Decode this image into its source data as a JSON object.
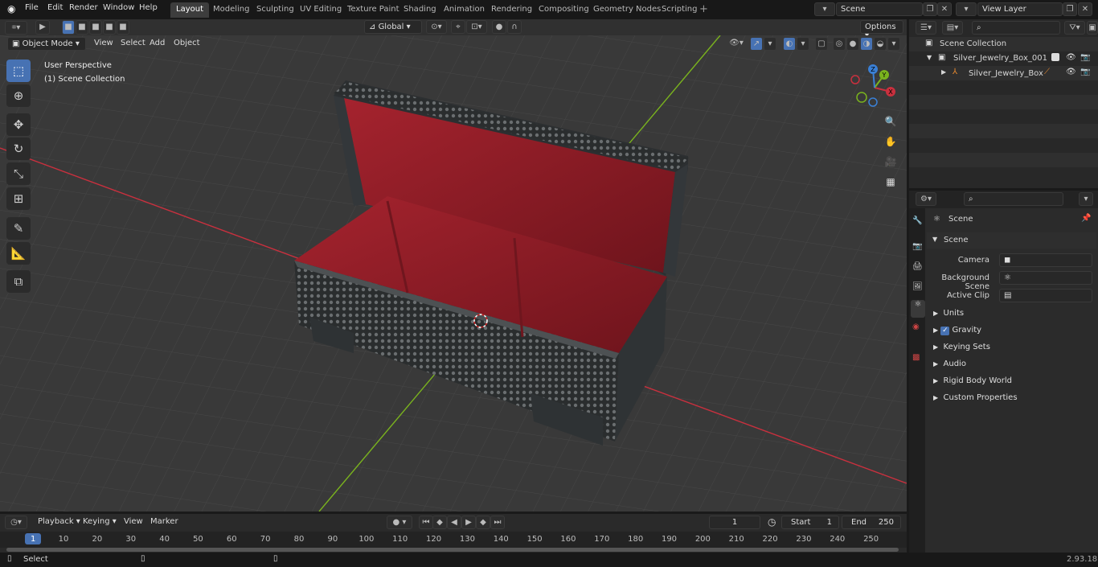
{
  "menu": [
    "File",
    "Edit",
    "Render",
    "Window",
    "Help"
  ],
  "workspaces": [
    "Layout",
    "Modeling",
    "Sculpting",
    "UV Editing",
    "Texture Paint",
    "Shading",
    "Animation",
    "Rendering",
    "Compositing",
    "Geometry Nodes",
    "Scripting"
  ],
  "scene_field": "Scene",
  "view_layer_field": "View Layer",
  "viewport": {
    "mode": "Object Mode",
    "menus": [
      "View",
      "Select",
      "Add",
      "Object"
    ],
    "transform_orientation": "Global",
    "options_label": "Options",
    "overlay_line1": "User Perspective",
    "overlay_line2": "(1) Scene Collection",
    "gizmo_axes": [
      "X",
      "Y",
      "Z"
    ]
  },
  "outliner": {
    "root": "Scene Collection",
    "collection": "Silver_Jewelry_Box_001",
    "object": "Silver_Jewelry_Box"
  },
  "properties": {
    "header": "Scene",
    "panel": "Scene",
    "fields": [
      {
        "label": "Camera",
        "value": ""
      },
      {
        "label": "Background Scene",
        "value": ""
      },
      {
        "label": "Active Clip",
        "value": ""
      }
    ],
    "sections": [
      "Units",
      "Gravity",
      "Keying Sets",
      "Audio",
      "Rigid Body World",
      "Custom Properties"
    ]
  },
  "timeline": {
    "menus": [
      "Playback",
      "Keying",
      "View",
      "Marker"
    ],
    "current_frame": "1",
    "start_label": "Start",
    "start_value": "1",
    "end_label": "End",
    "end_value": "250",
    "ticks": [
      "1",
      "10",
      "20",
      "30",
      "40",
      "50",
      "60",
      "70",
      "80",
      "90",
      "100",
      "110",
      "120",
      "130",
      "140",
      "150",
      "160",
      "170",
      "180",
      "190",
      "200",
      "210",
      "220",
      "230",
      "240",
      "250"
    ]
  },
  "status": {
    "left": "Select",
    "version": "2.93.18"
  },
  "colors": {
    "accent": "#4772b3",
    "x_axis": "#c9303e",
    "y_axis": "#7ab31e",
    "velvet": "#8a1a24"
  }
}
